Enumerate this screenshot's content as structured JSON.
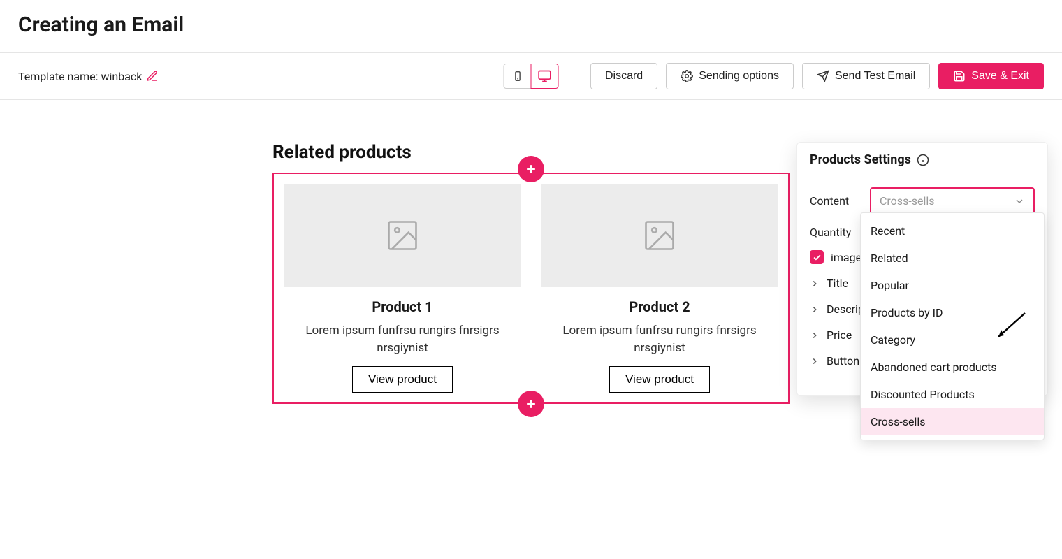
{
  "header": {
    "title": "Creating an Email"
  },
  "toolbar": {
    "template_label": "Template name: ",
    "template_name": "winback",
    "discard": "Discard",
    "sending_options": "Sending options",
    "send_test": "Send Test Email",
    "save_exit": "Save & Exit"
  },
  "block": {
    "section_title": "Related products",
    "products": [
      {
        "title": "Product 1",
        "desc": "Lorem ipsum funfrsu rungirs fnrsigrs nrsgiynist",
        "btn": "View product"
      },
      {
        "title": "Product 2",
        "desc": "Lorem ipsum funfrsu rungirs fnrsigrs nrsgiynist",
        "btn": "View product"
      }
    ]
  },
  "settings": {
    "title": "Products Settings",
    "content_label": "Content",
    "content_value": "Cross-sells",
    "quantity_label": "Quantity",
    "image_checkbox": "image",
    "fields": [
      "Title",
      "Description",
      "Price",
      "Button"
    ],
    "options": [
      "Recent",
      "Related",
      "Popular",
      "Products by ID",
      "Category",
      "Abandoned cart products",
      "Discounted Products",
      "Cross-sells"
    ]
  }
}
